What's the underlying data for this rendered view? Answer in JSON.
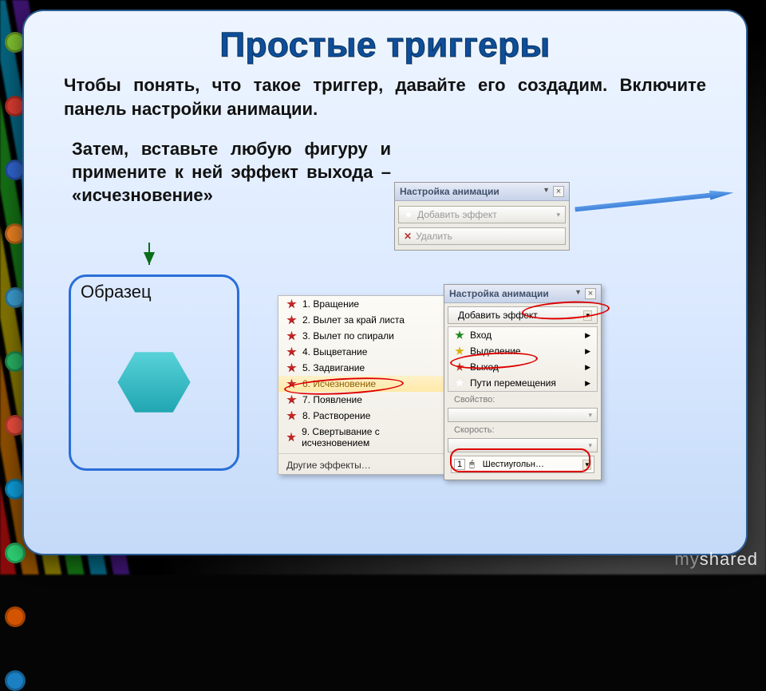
{
  "slide": {
    "title": "Простые триггеры",
    "para1": "Чтобы понять, что такое триггер, давайте его создадим.  Включите панель настройки анимации.",
    "para2": "Затем, вставьте любую фигуру и примените к ней эффект выхода – «исчезновение»",
    "sample_label": "Образец"
  },
  "panel_top": {
    "title": "Настройка анимации",
    "btn_add": "Добавить эффект",
    "btn_del": "Удалить"
  },
  "dropdown": {
    "title": "Настройка анимации",
    "btn_add": "Добавить эффект",
    "items": {
      "enter": "Вход",
      "emphasis": "Выделение",
      "exit": "Выход",
      "motion": "Пути перемещения"
    },
    "field_prop": "Свойство:",
    "field_speed": "Скорость:",
    "anim_slot": {
      "index": "1",
      "name": "Шестиугольн…"
    }
  },
  "fx": {
    "items": [
      "1. Вращение",
      "2. Вылет за край листа",
      "3. Вылет по спирали",
      "4. Выцветание",
      "5. Задвигание",
      "6. Исчезновение",
      "7. Появление",
      "8. Растворение",
      "9. Свертывание с исчезновением"
    ],
    "footer": "Другие эффекты…"
  },
  "dots": [
    "#7fbf2f",
    "#d63a2f",
    "#2f62c9",
    "#e67e22",
    "#3a9acb",
    "#27ae60",
    "#e74c3c",
    "#0e9bd6",
    "#2ecc71",
    "#d35400",
    "#1b7fc2",
    "#16a085"
  ],
  "watermark": {
    "pre": "my",
    "main": "shared"
  }
}
